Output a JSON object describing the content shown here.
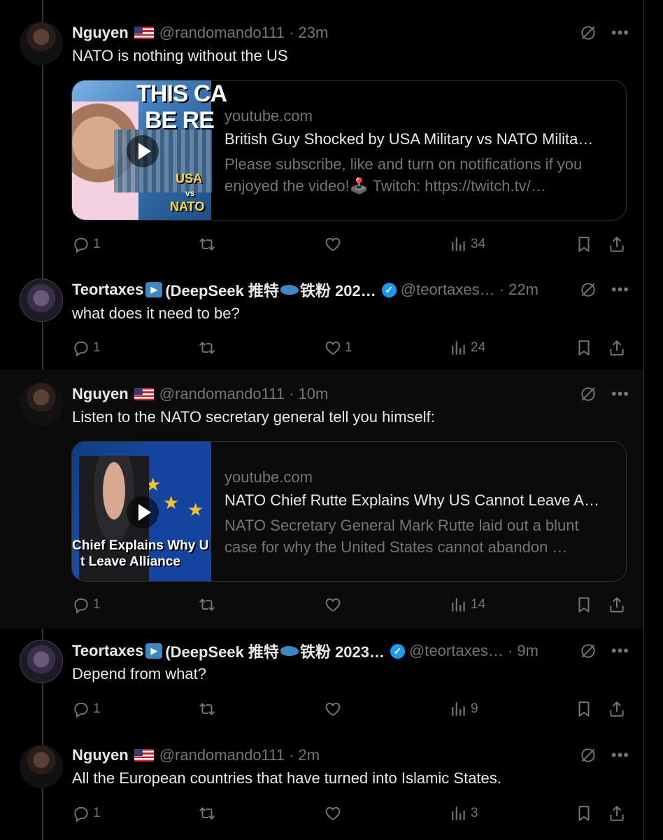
{
  "posts": [
    {
      "name": "Nguyen",
      "handle": "@randomando111 · 23m",
      "text": "NATO is nothing without the US",
      "card": {
        "domain": "youtube.com",
        "title": "British Guy Shocked by USA Military vs NATO Milita…",
        "desc1": "Please subscribe, like and turn on notifications if you",
        "desc2": "enjoyed the video!🕹️ Twitch: https://twitch.tv/…",
        "thumb_caption1": "THIS CA",
        "thumb_caption2": "BE RE",
        "thumb_label1": "USA",
        "thumb_label2": "vs",
        "thumb_label3": "NATO"
      },
      "stats": {
        "replies": "1",
        "reposts": "",
        "likes": "",
        "views": "34"
      }
    },
    {
      "name": "Teortaxes",
      "name_tail": " (DeepSeek 推特",
      "name_tail2": "铁粉 202…",
      "handle": "@teortaxes… · 22m",
      "text": "what does it need to be?",
      "stats": {
        "replies": "1",
        "reposts": "",
        "likes": "1",
        "views": "24"
      }
    },
    {
      "name": "Nguyen",
      "handle": "@randomando111 · 10m",
      "text": "Listen to the NATO secretary general tell you himself:",
      "card": {
        "domain": "youtube.com",
        "title": "NATO Chief Rutte Explains Why US Cannot Leave A…",
        "desc1": "NATO Secretary General Mark Rutte laid out a blunt",
        "desc2": "case for why the United States cannot abandon …",
        "thumb_caption1": "Chief Explains Why U",
        "thumb_caption2": "t Leave Alliance"
      },
      "stats": {
        "replies": "1",
        "reposts": "",
        "likes": "",
        "views": "14"
      }
    },
    {
      "name": "Teortaxes",
      "name_tail": " (DeepSeek 推特",
      "name_tail2": "铁粉 2023…",
      "handle": "@teortaxes… · 9m",
      "text": "Depend from what?",
      "stats": {
        "replies": "1",
        "reposts": "",
        "likes": "",
        "views": "9"
      }
    },
    {
      "name": "Nguyen",
      "handle": "@randomando111 · 2m",
      "text": "All the European countries that have turned into Islamic States.",
      "stats": {
        "replies": "1",
        "reposts": "",
        "likes": "",
        "views": "3"
      }
    }
  ],
  "icons": {
    "reply": "reply-icon",
    "repost": "repost-icon",
    "like": "heart-icon",
    "views": "views-icon",
    "bookmark": "bookmark-icon",
    "share": "share-icon",
    "grok": "grok-icon",
    "more": "more-icon"
  },
  "colors": {
    "background": "#000000",
    "text": "#e7e9ea",
    "muted": "#71767b",
    "verified": "#1d9bf0",
    "highlight": "#0b0b0b"
  }
}
